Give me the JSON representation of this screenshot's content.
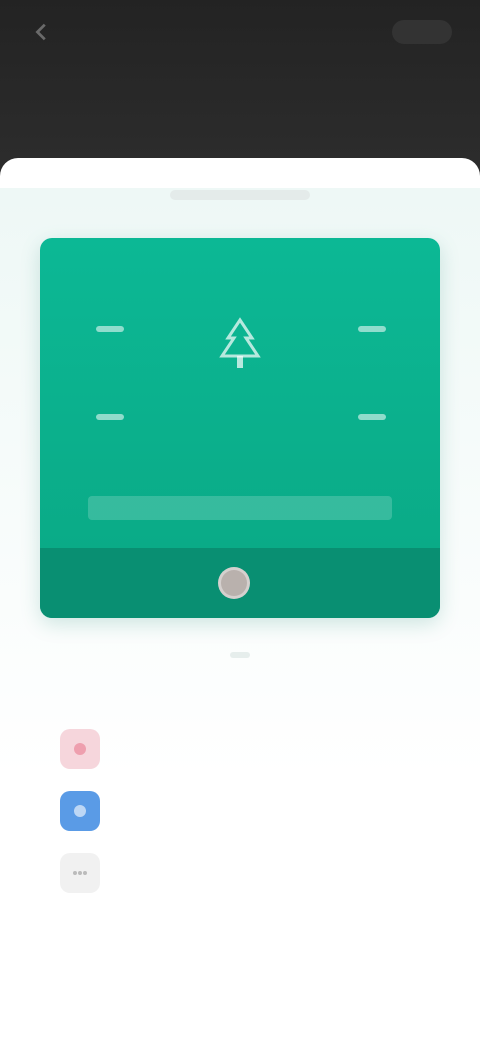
{
  "header": {
    "title": "",
    "back_icon": "arrow-left-icon"
  },
  "card": {
    "label": "",
    "value": "",
    "caption": "",
    "footer_text": "",
    "accent_color": "#0cb895",
    "footer_color": "#098f72"
  },
  "share": {
    "items": [
      {
        "label": "",
        "icon": "pink-share-icon",
        "color": "#f6d6dc"
      },
      {
        "label": "",
        "icon": "blue-share-icon",
        "color": "#5a9be6"
      },
      {
        "label": "",
        "icon": "more-icon",
        "color": "#f1f1f1"
      }
    ]
  },
  "note": {
    "text": "",
    "link": "",
    "link_color": "#e6586c"
  }
}
